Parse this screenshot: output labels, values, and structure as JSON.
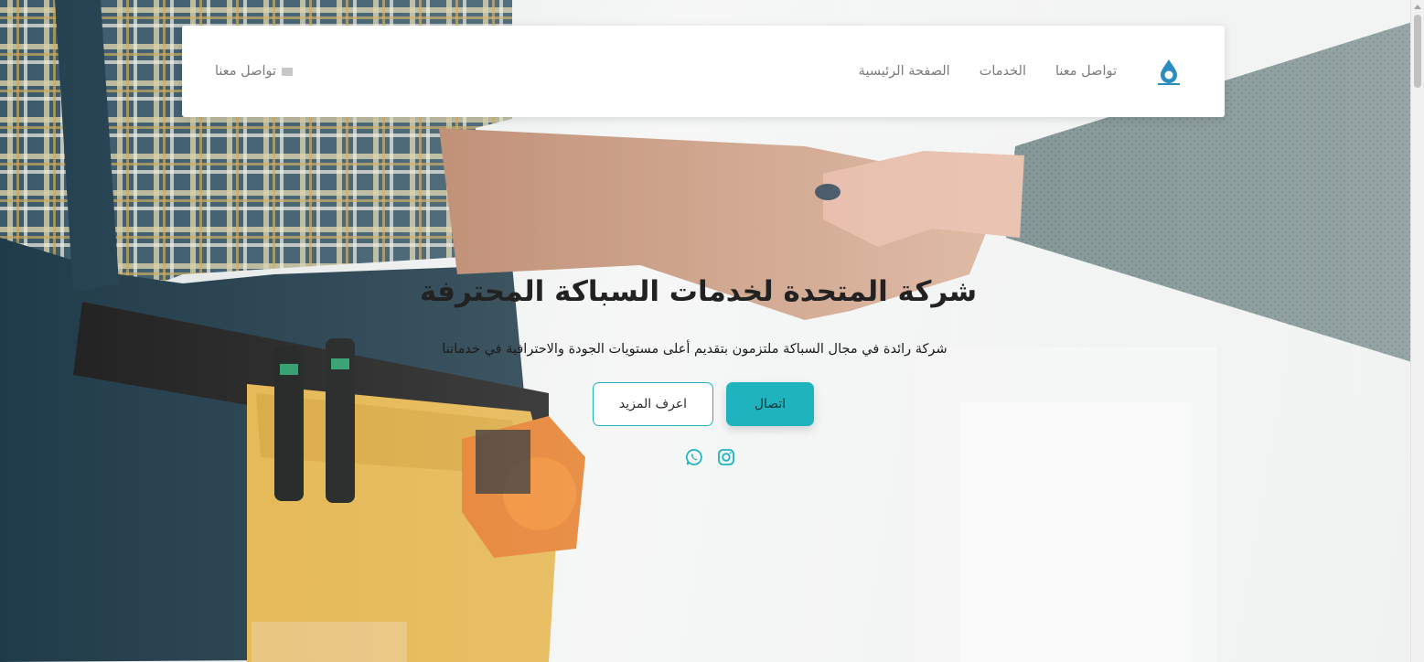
{
  "navbar": {
    "brand_logo": "company-drop-logo",
    "links": [
      {
        "label": "الصفحة الرئيسية"
      },
      {
        "label": "الخدمات"
      },
      {
        "label": "تواصل معنا"
      }
    ],
    "cta_label": "تواصل معنا",
    "cta_icon": "envelope-icon"
  },
  "hero": {
    "title": "شركة المتحدة لخدمات السباكة المحترفة",
    "subtitle": "شركة رائدة في مجال السباكة ملتزمون بتقديم أعلى مستويات الجودة والاحترافية في خدماتنا",
    "primary_button": "اتصال",
    "secondary_button": "اعرف المزيد",
    "social_icons": [
      "instagram-icon",
      "whatsapp-icon"
    ]
  },
  "colors": {
    "accent": "#1eb3bd",
    "nav_text": "#7b7b7b"
  }
}
